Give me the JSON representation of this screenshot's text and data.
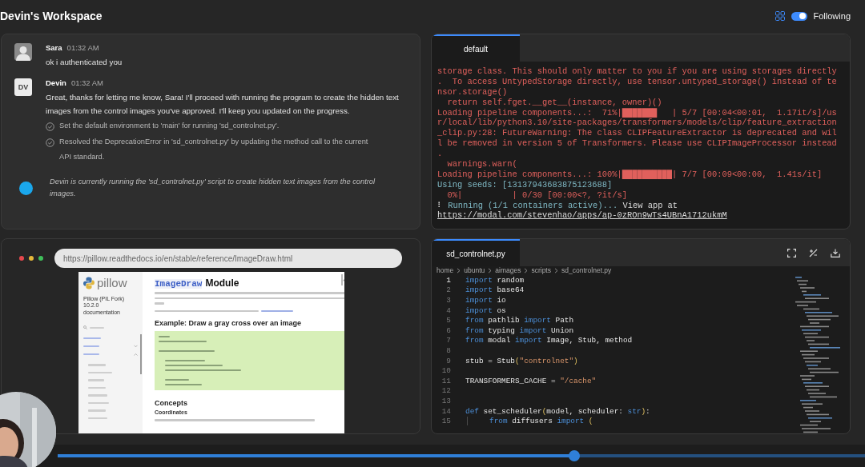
{
  "header": {
    "title": "Devin's Workspace",
    "following": {
      "label": "Following",
      "on": true
    }
  },
  "chat": {
    "messages": [
      {
        "author": "Sara",
        "time": "01:32 AM",
        "text": "ok i authenticated you"
      },
      {
        "author": "Devin",
        "time": "01:32 AM",
        "avatar": {
          "kind": "initials",
          "initials": "DV"
        },
        "text": "Great, thanks for letting me know, Sara! I'll proceed with running the program to create the hidden text images from the control images you've approved. I'll keep you updated on the progress.",
        "steps": [
          {
            "text": "Set the default environment to 'main' for running 'sd_controlnet.py'.",
            "done": true
          },
          {
            "text": "Resolved the DeprecationError in 'sd_controlnet.py' by updating the method call to the current API standard.",
            "done": true
          }
        ]
      }
    ],
    "status": {
      "text": "Devin is currently running the 'sd_controlnet.py' script to create hidden text images from the control images.",
      "active": true
    }
  },
  "terminal": {
    "tabs": [
      {
        "label": "default",
        "selected": true
      }
    ],
    "lines": [
      [
        {
          "kind": "error",
          "text": "storage class. This should only matter to you if you are using storages directly"
        }
      ],
      [
        {
          "kind": "error",
          "text": ".  To access UntypedStorage directly, use tensor.untyped_storage() instead of te"
        }
      ],
      [
        {
          "kind": "error",
          "text": "nsor.storage()"
        }
      ],
      [
        {
          "kind": "error",
          "text": "  return self.fget.__get__(instance, owner)()"
        }
      ],
      [
        {
          "kind": "error",
          "text": "Loading pipeline components...:  71%|███████   | 5/7 [00:04<00:01,  1.17it/s]/us"
        }
      ],
      [
        {
          "kind": "error",
          "text": "r/local/lib/python3.10/site-packages/transformers/models/clip/feature_extraction"
        }
      ],
      [
        {
          "kind": "error",
          "text": "_clip.py:28: FutureWarning: The class CLIPFeatureExtractor is deprecated and wil"
        }
      ],
      [
        {
          "kind": "error",
          "text": "l be removed in version 5 of Transformers. Please use CLIPImageProcessor instead"
        }
      ],
      [
        {
          "kind": "error",
          "text": "."
        }
      ],
      [
        {
          "kind": "error",
          "text": "  warnings.warn("
        }
      ],
      [
        {
          "kind": "error",
          "text": "Loading pipeline components...: 100%|██████████| 7/7 [00:09<00:00,  1.41s/it]"
        }
      ],
      [
        {
          "kind": "info",
          "text": "Using seeds: [13137943683875123688]"
        }
      ],
      [
        {
          "kind": "error",
          "text": "  0%|          | 0/30 [00:00<?, ?it/s]"
        }
      ],
      [
        {
          "kind": "plain",
          "text": "⠇"
        },
        {
          "kind": "info",
          "text": " Running (1/1 containers active)..."
        },
        {
          "kind": "plain",
          "text": " View app at"
        }
      ],
      [
        {
          "kind": "link",
          "text": "https://modal.com/stevenhao/apps/ap-0zROn9wTs4UBnA1712ukmM"
        }
      ]
    ]
  },
  "browser": {
    "url": "https://pillow.readthedocs.io/en/stable/reference/ImageDraw.html",
    "page": {
      "logo": "pillow",
      "project": "Pillow (PIL Fork) 10.2.0 documentation",
      "nav": [
        {
          "kind": "link"
        },
        {
          "kind": "group",
          "expanded": false
        },
        {
          "kind": "group",
          "expanded": true
        }
      ],
      "title_code": "ImageDraw",
      "title_rest": "Module",
      "example_heading": "Example: Draw a gray cross over an image",
      "concepts_heading": "Concepts",
      "coordinates_heading": "Coordinates"
    }
  },
  "editor": {
    "tabs": [
      {
        "label": "sd_controlnet.py",
        "selected": true
      }
    ],
    "breadcrumb": [
      "home",
      "ubuntu",
      "aimages",
      "scripts",
      "sd_controlnet.py"
    ],
    "lines": [
      {
        "number": "1",
        "tokens": [
          {
            "kind": "keyword",
            "text": "import"
          },
          {
            "kind": "text",
            "text": " random"
          }
        ]
      },
      {
        "number": "2",
        "tokens": [
          {
            "kind": "keyword",
            "text": "import"
          },
          {
            "kind": "text",
            "text": " base64"
          }
        ]
      },
      {
        "number": "3",
        "tokens": [
          {
            "kind": "keyword",
            "text": "import"
          },
          {
            "kind": "text",
            "text": " io"
          }
        ]
      },
      {
        "number": "4",
        "tokens": [
          {
            "kind": "keyword",
            "text": "import"
          },
          {
            "kind": "text",
            "text": " os"
          }
        ]
      },
      {
        "number": "5",
        "tokens": [
          {
            "kind": "keyword",
            "text": "from"
          },
          {
            "kind": "text",
            "text": " pathlib "
          },
          {
            "kind": "keyword",
            "text": "import"
          },
          {
            "kind": "text",
            "text": " Path"
          }
        ]
      },
      {
        "number": "6",
        "tokens": [
          {
            "kind": "keyword",
            "text": "from"
          },
          {
            "kind": "text",
            "text": " typing "
          },
          {
            "kind": "keyword",
            "text": "import"
          },
          {
            "kind": "text",
            "text": " Union"
          }
        ]
      },
      {
        "number": "7",
        "tokens": [
          {
            "kind": "keyword",
            "text": "from"
          },
          {
            "kind": "text",
            "text": " modal "
          },
          {
            "kind": "keyword",
            "text": "import"
          },
          {
            "kind": "text",
            "text": " Image, Stub, method"
          }
        ]
      },
      {
        "number": "8"
      },
      {
        "number": "9",
        "tokens": [
          {
            "kind": "text",
            "text": "stub = Stub"
          },
          {
            "kind": "paren",
            "text": "("
          },
          {
            "kind": "string",
            "text": "\"controlnet\""
          },
          {
            "kind": "paren",
            "text": ")"
          }
        ]
      },
      {
        "number": "10"
      },
      {
        "number": "11",
        "tokens": [
          {
            "kind": "text",
            "text": "TRANSFORMERS_CACHE = "
          },
          {
            "kind": "string",
            "text": "\"/cache\""
          }
        ]
      },
      {
        "number": "12"
      },
      {
        "number": "13"
      },
      {
        "number": "14",
        "tokens": [
          {
            "kind": "keyword",
            "text": "def"
          },
          {
            "kind": "text",
            "text": " set_scheduler"
          },
          {
            "kind": "paren",
            "text": "("
          },
          {
            "kind": "text",
            "text": "model, scheduler: "
          },
          {
            "kind": "keyword",
            "text": "str"
          },
          {
            "kind": "paren",
            "text": ")"
          },
          {
            "kind": "text",
            "text": ":"
          }
        ]
      },
      {
        "number": "15",
        "indented": true,
        "tokens": [
          {
            "kind": "keyword",
            "text": "from"
          },
          {
            "kind": "text",
            "text": " diffusers "
          },
          {
            "kind": "keyword",
            "text": "import"
          },
          {
            "kind": "paren",
            "text": " ("
          }
        ]
      }
    ]
  },
  "video": {
    "progress": {
      "level": 0.64
    }
  }
}
